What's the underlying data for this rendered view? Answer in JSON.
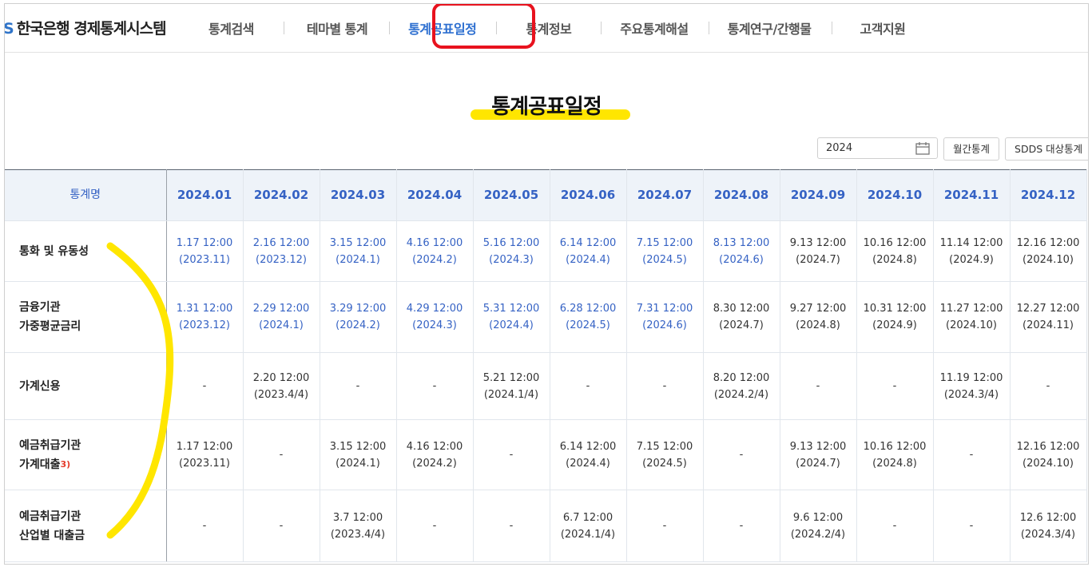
{
  "header": {
    "logo_mark": "S",
    "logo_text": "한국은행 경제통계시스템",
    "nav": [
      {
        "label": "통계검색"
      },
      {
        "label": "테마별 통계"
      },
      {
        "label": "통계공표일정"
      },
      {
        "label": "통계정보"
      },
      {
        "label": "주요통계해설"
      },
      {
        "label": "통계연구/간행물"
      },
      {
        "label": "고객지원"
      }
    ]
  },
  "page": {
    "title": "통계공표일정",
    "year_value": "2024",
    "monthly_button": "월간통계",
    "sdds_button": "SDDS 대상통계"
  },
  "table": {
    "name_header": "통계명",
    "months": [
      "2024.01",
      "2024.02",
      "2024.03",
      "2024.04",
      "2024.05",
      "2024.06",
      "2024.07",
      "2024.08",
      "2024.09",
      "2024.10",
      "2024.11",
      "2024.12"
    ],
    "rows": [
      {
        "name": [
          "통화 및 유동성"
        ],
        "sup": "",
        "cells": [
          [
            "1.17 12:00",
            "(2023.11)",
            true
          ],
          [
            "2.16 12:00",
            "(2023.12)",
            true
          ],
          [
            "3.15 12:00",
            "(2024.1)",
            true
          ],
          [
            "4.16 12:00",
            "(2024.2)",
            true
          ],
          [
            "5.16 12:00",
            "(2024.3)",
            true
          ],
          [
            "6.14 12:00",
            "(2024.4)",
            true
          ],
          [
            "7.15 12:00",
            "(2024.5)",
            true
          ],
          [
            "8.13 12:00",
            "(2024.6)",
            true
          ],
          [
            "9.13 12:00",
            "(2024.7)",
            false
          ],
          [
            "10.16 12:00",
            "(2024.8)",
            false
          ],
          [
            "11.14 12:00",
            "(2024.9)",
            false
          ],
          [
            "12.16 12:00",
            "(2024.10)",
            false
          ]
        ]
      },
      {
        "name": [
          "금융기관",
          "가중평균금리"
        ],
        "sup": "",
        "cells": [
          [
            "1.31 12:00",
            "(2023.12)",
            true
          ],
          [
            "2.29 12:00",
            "(2024.1)",
            true
          ],
          [
            "3.29 12:00",
            "(2024.2)",
            true
          ],
          [
            "4.29 12:00",
            "(2024.3)",
            true
          ],
          [
            "5.31 12:00",
            "(2024.4)",
            true
          ],
          [
            "6.28 12:00",
            "(2024.5)",
            true
          ],
          [
            "7.31 12:00",
            "(2024.6)",
            true
          ],
          [
            "8.30 12:00",
            "(2024.7)",
            false
          ],
          [
            "9.27 12:00",
            "(2024.8)",
            false
          ],
          [
            "10.31 12:00",
            "(2024.9)",
            false
          ],
          [
            "11.27 12:00",
            "(2024.10)",
            false
          ],
          [
            "12.27 12:00",
            "(2024.11)",
            false
          ]
        ]
      },
      {
        "name": [
          "가계신용"
        ],
        "sup": "",
        "cells": [
          [
            "-",
            "",
            false
          ],
          [
            "2.20 12:00",
            "(2023.4/4)",
            false
          ],
          [
            "-",
            "",
            false
          ],
          [
            "-",
            "",
            false
          ],
          [
            "5.21 12:00",
            "(2024.1/4)",
            false
          ],
          [
            "-",
            "",
            false
          ],
          [
            "-",
            "",
            false
          ],
          [
            "8.20 12:00",
            "(2024.2/4)",
            false
          ],
          [
            "-",
            "",
            false
          ],
          [
            "-",
            "",
            false
          ],
          [
            "11.19 12:00",
            "(2024.3/4)",
            false
          ],
          [
            "-",
            "",
            false
          ]
        ]
      },
      {
        "name": [
          "예금취급기관",
          "가계대출"
        ],
        "sup": "3)",
        "cells": [
          [
            "1.17 12:00",
            "(2023.11)",
            false
          ],
          [
            "-",
            "",
            false
          ],
          [
            "3.15 12:00",
            "(2024.1)",
            false
          ],
          [
            "4.16 12:00",
            "(2024.2)",
            false
          ],
          [
            "-",
            "",
            false
          ],
          [
            "6.14 12:00",
            "(2024.4)",
            false
          ],
          [
            "7.15 12:00",
            "(2024.5)",
            false
          ],
          [
            "-",
            "",
            false
          ],
          [
            "9.13 12:00",
            "(2024.7)",
            false
          ],
          [
            "10.16 12:00",
            "(2024.8)",
            false
          ],
          [
            "-",
            "",
            false
          ],
          [
            "12.16 12:00",
            "(2024.10)",
            false
          ]
        ]
      },
      {
        "name": [
          "예금취급기관",
          "산업별 대출금"
        ],
        "sup": "",
        "cells": [
          [
            "-",
            "",
            false
          ],
          [
            "-",
            "",
            false
          ],
          [
            "3.7 12:00",
            "(2023.4/4)",
            false
          ],
          [
            "-",
            "",
            false
          ],
          [
            "-",
            "",
            false
          ],
          [
            "6.7 12:00",
            "(2024.1/4)",
            false
          ],
          [
            "-",
            "",
            false
          ],
          [
            "-",
            "",
            false
          ],
          [
            "9.6 12:00",
            "(2024.2/4)",
            false
          ],
          [
            "-",
            "",
            false
          ],
          [
            "-",
            "",
            false
          ],
          [
            "12.6 12:00",
            "(2024.3/4)",
            false
          ]
        ]
      }
    ]
  },
  "colors": {
    "accent": "#2d6fd0",
    "highlight_box": "#e8121e",
    "marker": "#ffe600"
  }
}
